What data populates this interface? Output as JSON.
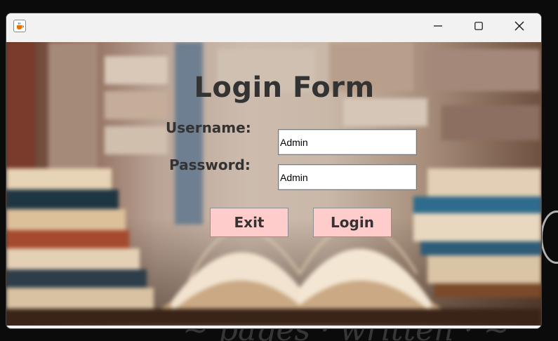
{
  "window": {
    "title": "",
    "controls": {
      "minimize": "minimize-icon",
      "maximize": "maximize-icon",
      "close": "close-icon"
    },
    "app_icon": "java-cup-icon"
  },
  "form": {
    "title": "Login Form",
    "username_label": "Username:",
    "username_value": "Admin",
    "password_label": "Password:",
    "password_value": "Admin",
    "exit_label": "Exit",
    "login_label": "Login"
  },
  "colors": {
    "button_bg": "#ffcccc",
    "text": "#333333"
  }
}
